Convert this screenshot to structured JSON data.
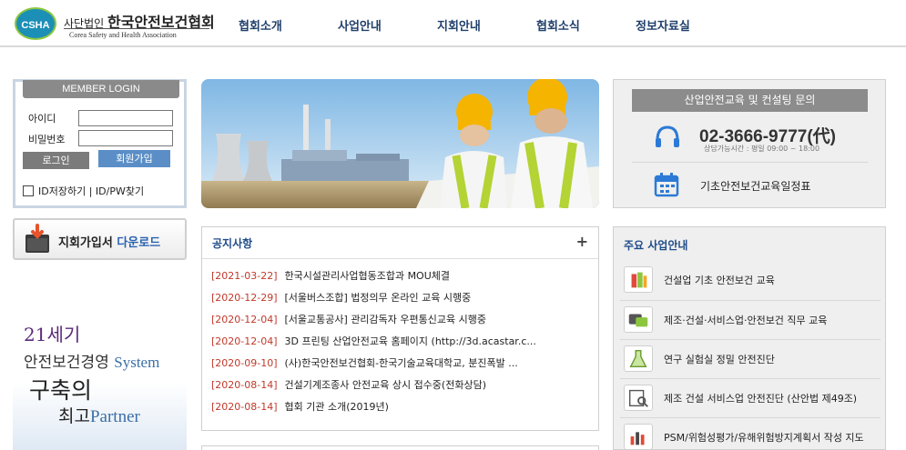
{
  "logo": {
    "badge": "CSHA",
    "prefix": "사단법인",
    "name": "한국안전보건협회",
    "english": "Corea Safety and Health Association"
  },
  "nav": [
    {
      "label": "협회소개"
    },
    {
      "label": "사업안내"
    },
    {
      "label": "지회안내"
    },
    {
      "label": "협회소식"
    },
    {
      "label": "정보자료실"
    }
  ],
  "login": {
    "title": "MEMBER LOGIN",
    "id_label": "아이디",
    "pw_label": "비밀번호",
    "id_value": "",
    "pw_value": "",
    "login_button": "로그인",
    "join_button": "회원가입",
    "footer": "ID저장하기  |  ID/PW찾기"
  },
  "download": {
    "text": "지회가입서",
    "accent": "다운로드"
  },
  "slogan": {
    "line1": "21세기",
    "line2_ko": "안전보건경영",
    "line2_en": "System",
    "line3": "구축의",
    "line4_ko": "최고",
    "line4_en": "Partner"
  },
  "notice": {
    "title": "공지사항",
    "more": "+",
    "items": [
      {
        "date": "[2021-03-22]",
        "text": "한국시설관리사업협동조합과 MOU체결"
      },
      {
        "date": "[2020-12-29]",
        "text": "[서울버스조합] 법정의무 온라인 교육 시행중"
      },
      {
        "date": "[2020-12-04]",
        "text": "[서울교통공사] 관리감독자 우편통신교육 시행중"
      },
      {
        "date": "[2020-12-04]",
        "text": "3D 프린팅 산업안전교육 홈페이지 (http://3d.acastar.c..."
      },
      {
        "date": "[2020-09-10]",
        "text": "(사)한국안전보건협회-한국기술교육대학교, 분진폭발 ..."
      },
      {
        "date": "[2020-08-14]",
        "text": "건설기계조종사 안전교육 상시 접수중(전화상담)"
      },
      {
        "date": "[2020-08-14]",
        "text": "협회 기관 소개(2019년)"
      }
    ]
  },
  "consult": {
    "title": "산업안전교육 및 컨설팅 문의",
    "phone": "02-3666-9777(代)",
    "hours": "상담가능시간 : 평일 09:00 ~ 18:00",
    "schedule": "기초안전보건교육일정표"
  },
  "business": {
    "title": "주요 사업안내",
    "items": [
      {
        "label": "건설업 기초 안전보건 교육",
        "icon": "bottles-icon"
      },
      {
        "label": "제조·건설·서비스업·안전보건 직무 교육",
        "icon": "chat-icon"
      },
      {
        "label": "연구 실험실 정밀 안전진단",
        "icon": "flask-icon"
      },
      {
        "label": "제조 건설 서비스업 안전진단 (산안법 제49조)",
        "icon": "inspect-icon"
      },
      {
        "label": "PSM/위험성평가/유해위험방지계획서 작성 지도",
        "icon": "chart-icon"
      }
    ]
  },
  "colors": {
    "nav": "#1f3f6b",
    "notice_date": "#c0392b",
    "accent_blue": "#2a62b0",
    "panel_gray": "#8c8c8c"
  }
}
